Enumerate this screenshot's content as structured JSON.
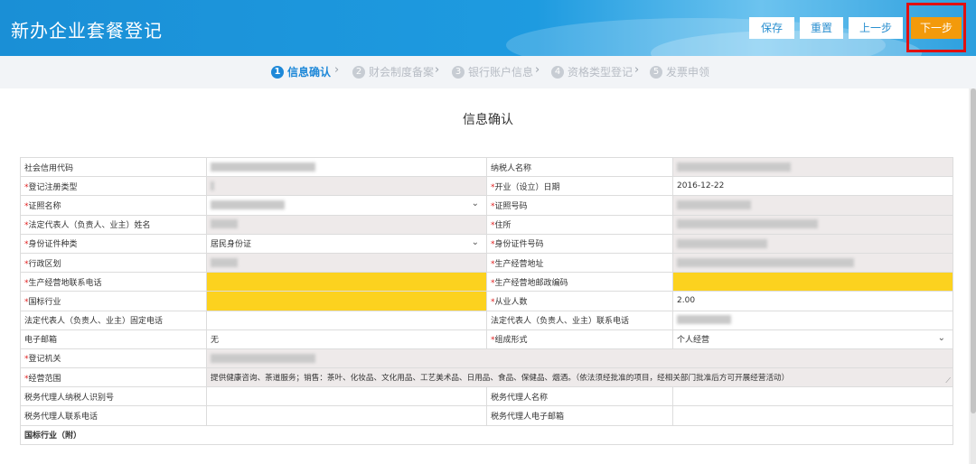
{
  "header": {
    "title": "新办企业套餐登记",
    "buttons": {
      "save": "保存",
      "reset": "重置",
      "prev": "上一步",
      "next": "下一步"
    }
  },
  "steps": [
    {
      "num": "1",
      "label": "信息确认",
      "active": true
    },
    {
      "num": "2",
      "label": "财会制度备案"
    },
    {
      "num": "3",
      "label": "银行账户信息"
    },
    {
      "num": "4",
      "label": "资格类型登记"
    },
    {
      "num": "5",
      "label": "发票申领"
    }
  ],
  "page_title": "信息确认",
  "form": {
    "credit_code_label": "社会信用代码",
    "taxpayer_name_label": "纳税人名称",
    "reg_type_label": "登记注册类型",
    "open_date_label": "开业（设立）日期",
    "open_date_value": "2016-12-22",
    "cert_name_label": "证照名称",
    "cert_no_label": "证照号码",
    "legal_rep_label": "法定代表人（负责人、业主）姓名",
    "address_label": "住所",
    "id_type_label": "身份证件种类",
    "id_type_value": "居民身份证",
    "id_no_label": "身份证件号码",
    "admin_region_label": "行政区划",
    "biz_address_label": "生产经营地址",
    "biz_phone_label": "生产经营地联系电话",
    "biz_postcode_label": "生产经营地邮政编码",
    "industry_label": "国标行业",
    "employees_label": "从业人数",
    "employees_value": "2.00",
    "legal_fixed_phone_label": "法定代表人（负责人、业主）固定电话",
    "legal_mobile_label": "法定代表人（负责人、业主）联系电话",
    "email_label": "电子邮箱",
    "email_value": "无",
    "org_form_label": "组成形式",
    "org_form_value": "个人经营",
    "reg_authority_label": "登记机关",
    "scope_label": "经营范围",
    "scope_value": "提供健康咨询、茶道服务；销售：茶叶、化妆品、文化用品、工艺美术品、日用品、食品、保健品、烟酒。（依法须经批准的项目，经相关部门批准后方可开展经营活动）",
    "agent_id_label": "税务代理人纳税人识别号",
    "agent_name_label": "税务代理人名称",
    "agent_phone_label": "税务代理人联系电话",
    "agent_email_label": "税务代理人电子邮箱",
    "industry_sub_label": "国标行业（附）"
  },
  "colors": {
    "accent": "#1e88d8",
    "next_button": "#f39a0b",
    "highlight": "#fcd21f",
    "annotation": "#e11010"
  }
}
